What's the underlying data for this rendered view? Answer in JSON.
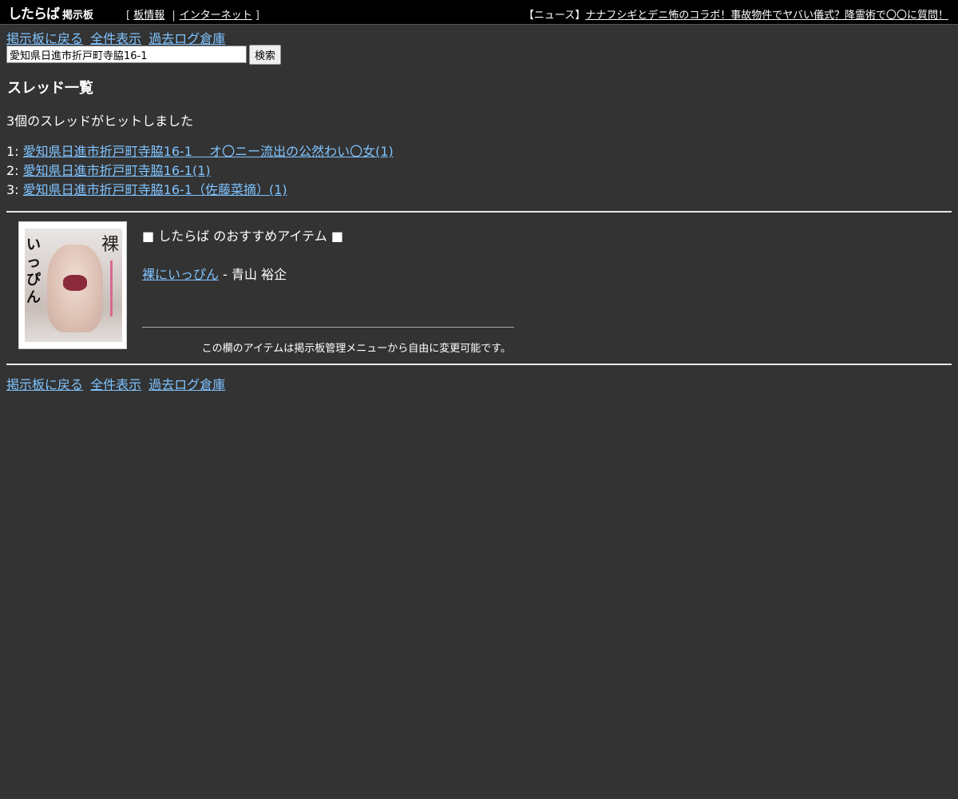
{
  "topbar": {
    "logo": "したらば",
    "logo_sub": "掲示板",
    "nav": {
      "open": "[",
      "board_info": "板情報",
      "divider": "|",
      "category": "インターネット",
      "close": "]"
    },
    "news": {
      "label": "【ニュース】",
      "headline": "ナナフシギとデニ怖のコラボ！事故物件でヤバい儀式？降霊術で〇〇に質問！"
    }
  },
  "nav_links": {
    "back": "掲示板に戻る",
    "all": "全件表示",
    "archive": "過去ログ倉庫"
  },
  "search": {
    "value": "愛知県日進市折戸町寺脇16-1",
    "button": "検索"
  },
  "heading": "スレッド一覧",
  "hit_count_text": "3個のスレッドがヒットしました",
  "threads": [
    {
      "num": "1:",
      "title": "愛知県日進市折戸町寺脇16-1 　オ〇ニー流出の公然わい〇女(1)"
    },
    {
      "num": "2:",
      "title": "愛知県日進市折戸町寺脇16-1(1)"
    },
    {
      "num": "3:",
      "title": "愛知県日進市折戸町寺脇16-1（佐藤菜摘）(1)"
    }
  ],
  "recommend": {
    "sq_left": "■",
    "heading": "したらば のおすすめアイテム",
    "sq_right": "■",
    "item_title": "裸にいっぴん",
    "item_sep": "-",
    "item_author": "青山 裕企",
    "note": "この欄のアイテムは掲示板管理メニューから自由に変更可能です。",
    "cover_title_char": "裸",
    "cover_side_text": "いっぴん"
  },
  "colors": {
    "background": "#333333",
    "topbar": "#000000",
    "link": "#7fc3ff",
    "text": "#ffffff"
  }
}
